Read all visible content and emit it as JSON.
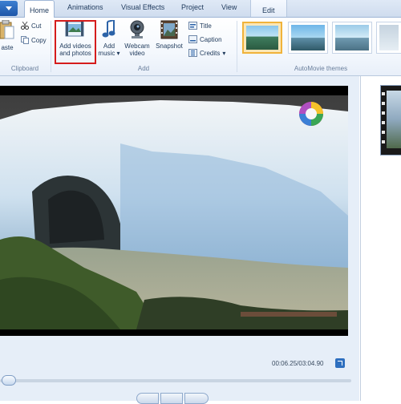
{
  "tabs": [
    {
      "label": "Home",
      "active": true
    },
    {
      "label": "Animations"
    },
    {
      "label": "Visual Effects"
    },
    {
      "label": "Project"
    },
    {
      "label": "View"
    },
    {
      "label": "Edit",
      "contextual": true
    }
  ],
  "clipboard": {
    "paste_label": "aste",
    "cut_label": "Cut",
    "copy_label": "Copy",
    "group_label": "Clipboard"
  },
  "add_group": {
    "add_videos_line1": "Add videos",
    "add_videos_line2": "and photos",
    "add_music_line1": "Add",
    "add_music_line2": "music",
    "webcam_line1": "Webcam",
    "webcam_line2": "video",
    "snapshot_label": "Snapshot",
    "title_label": "Title",
    "caption_label": "Caption",
    "credits_label": "Credits",
    "group_label": "Add"
  },
  "themes": {
    "group_label": "AutoMovie themes",
    "selected_index": 0,
    "count_visible": 4
  },
  "player": {
    "timecode": "00:06.25/03:04.90",
    "progress_fraction": 0.034
  },
  "colors": {
    "accent_blue": "#2e6fbf",
    "highlight_red": "#d51c1c",
    "ribbon_text": "#1e395b"
  }
}
